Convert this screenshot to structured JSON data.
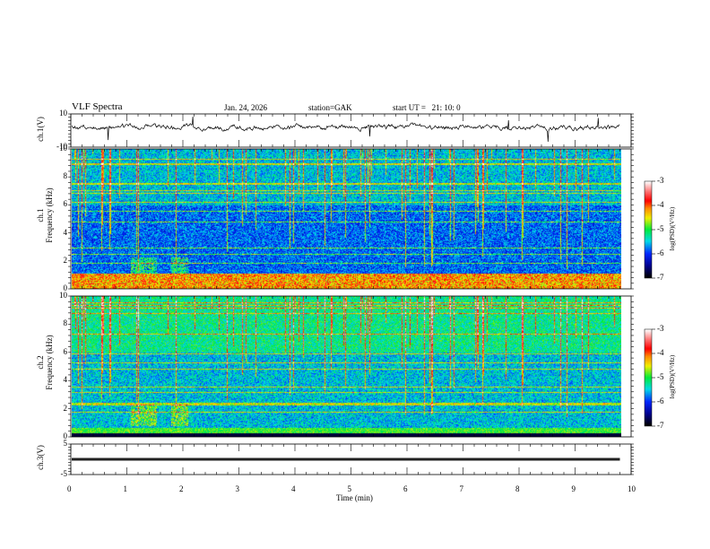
{
  "header": {
    "title": "VLF Spectra",
    "date": "Jan. 24, 2026",
    "station": "station=GAK",
    "start_ut": "start UT =   21: 10: 0"
  },
  "chart_data": [
    {
      "type": "line",
      "panel": "ch1-waveform",
      "ylabel": "ch.1(V)",
      "ylim": [
        -10,
        10
      ],
      "yticks": [
        "10",
        "-10"
      ],
      "xlim": [
        0,
        10
      ],
      "data_extent_min": 9.8,
      "baseline_v": 1,
      "color": "#000000"
    },
    {
      "type": "heatmap",
      "panel": "ch1-spectrogram",
      "ylabel": "ch.1\nFrequency (kHz)",
      "ylabel_lines": [
        "ch.1",
        "Frequency (kHz)"
      ],
      "ylim": [
        0,
        10
      ],
      "yticks": [
        "0",
        "2",
        "4",
        "6",
        "8",
        "10"
      ],
      "xlim": [
        0,
        10
      ],
      "colorbar": {
        "label": "log(PSD)(V²/Hz)",
        "range": [
          -7,
          -3
        ],
        "ticks": [
          "-3",
          "-4",
          "-5",
          "-6",
          "-7"
        ]
      }
    },
    {
      "type": "heatmap",
      "panel": "ch2-spectrogram",
      "ylabel_lines": [
        "ch.2",
        "Frequency (kHz)"
      ],
      "ylim": [
        0,
        10
      ],
      "yticks": [
        "0",
        "2",
        "4",
        "6",
        "8",
        "10"
      ],
      "xlim": [
        0,
        10
      ],
      "colorbar": {
        "label": "log(PSD)(V²/Hz)",
        "range": [
          -7,
          -3
        ],
        "ticks": [
          "-3",
          "-4",
          "-5",
          "-6",
          "-7"
        ]
      }
    },
    {
      "type": "line",
      "panel": "ch3-waveform",
      "ylabel": "ch.3(V)",
      "ylim": [
        -5,
        5
      ],
      "yticks": [
        "5",
        "-5"
      ],
      "xlim": [
        0,
        10
      ],
      "baseline_v": 0,
      "color": "#000000"
    }
  ],
  "xaxis": {
    "label": "Time (min)",
    "ticks": [
      "0",
      "1",
      "2",
      "3",
      "4",
      "5",
      "6",
      "7",
      "8",
      "9",
      "10"
    ]
  }
}
